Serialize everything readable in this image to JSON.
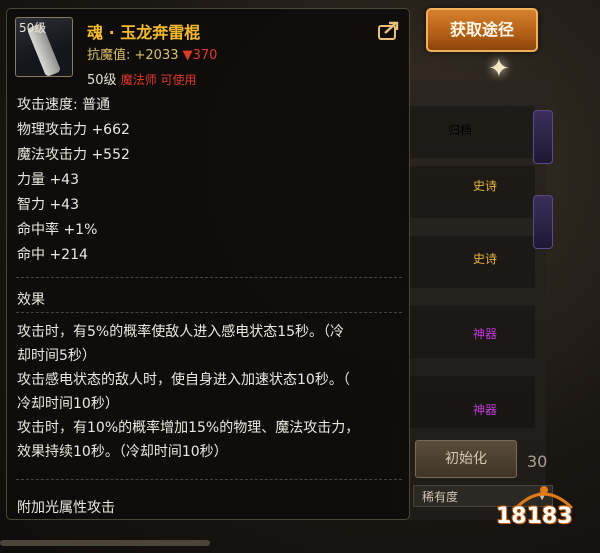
{
  "item": {
    "level_badge": "50级",
    "name": "魂 · 玉龙奔雷棍",
    "resist_label": "抗魔值: +2033",
    "resist_down": "▼370",
    "level_req": "50级",
    "class_req": "魔法师 可使用",
    "stats": [
      "攻击速度: 普通",
      "物理攻击力 +662",
      "魔法攻击力 +552",
      "力量 +43",
      "智力 +43",
      "命中率 +1%",
      "命中 +214"
    ],
    "effect_title": "效果",
    "effect_lines": [
      "攻击时，有5%的概率使敌人进入感电状态15秒。（冷",
      "却时间5秒）",
      "攻击感电状态的敌人时，使自身进入加速状态10秒。（",
      "冷却时间10秒）",
      "攻击时，有10%的概率增加15%的物理、魔法攻击力，",
      "效果持续10秒。（冷却时间10秒）"
    ],
    "extra": "附加光属性攻击"
  },
  "acquire_button": "获取途径",
  "background": {
    "tags": [
      {
        "label": "归档",
        "color": "#d8cdb8"
      },
      {
        "label": "史诗",
        "color": "#e9b43a"
      },
      {
        "label": "史诗",
        "color": "#e9b43a"
      },
      {
        "label": "神器",
        "color": "#c23bd8"
      },
      {
        "label": "神器",
        "color": "#c23bd8"
      }
    ],
    "init_button": "初始化",
    "rarity": "稀有度",
    "number": "30"
  },
  "logo": "18183"
}
